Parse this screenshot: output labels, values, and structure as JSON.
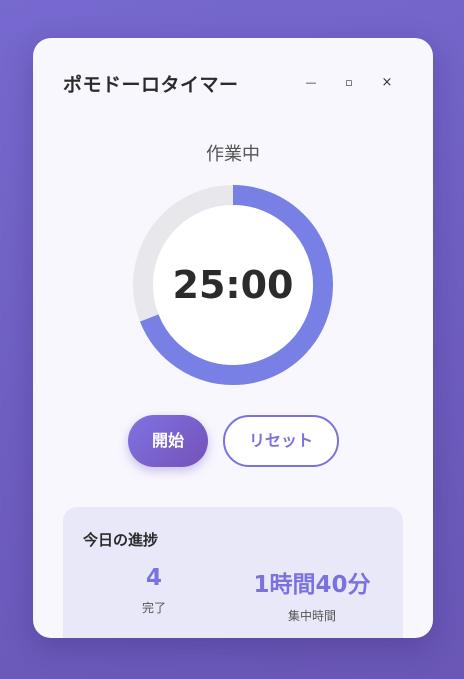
{
  "window": {
    "title": "ポモドーロタイマー",
    "controls": {
      "minimize": "—",
      "maximize": "▫",
      "close": "×"
    }
  },
  "timer": {
    "status": "作業中",
    "time": "25:00",
    "progress_fraction": 0.69,
    "ring_color": "#7880e6",
    "track_color": "#e8e8ec"
  },
  "actions": {
    "start_label": "開始",
    "reset_label": "リセット"
  },
  "progress": {
    "title": "今日の進捗",
    "completed_value": "4",
    "completed_label": "完了",
    "focus_value": "1時間40分",
    "focus_label": "集中時間"
  },
  "colors": {
    "accent": "#7a72de",
    "background": "#7166c8"
  }
}
